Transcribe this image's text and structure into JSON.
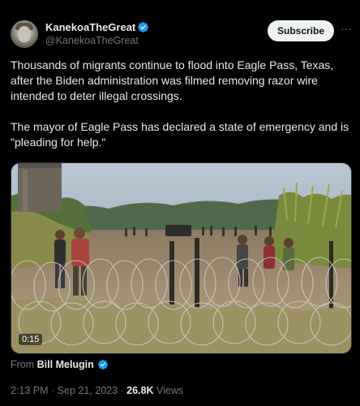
{
  "author": {
    "display_name": "KanekoaTheGreat",
    "handle": "@KanekoaTheGreat",
    "verified_color": "#1d9bf0"
  },
  "header": {
    "subscribe_label": "Subscribe",
    "more_label": "···"
  },
  "tweet": {
    "paragraph_1": "Thousands of migrants continue to flood into Eagle Pass, Texas, after the Biden administration was filmed removing razor wire intended to deter illegal crossings.",
    "paragraph_2": "The mayor of Eagle Pass has declared a state of emergency and is \"pleading for help.\""
  },
  "media": {
    "video_timer": "0:15"
  },
  "attribution": {
    "from_label": "From",
    "source_name": "Bill Melugin"
  },
  "meta": {
    "time": "2:13 PM",
    "separator": " · ",
    "date": "Sep 21, 2023",
    "views_count": "26.8K",
    "views_label": "Views"
  },
  "colors": {
    "background": "#000000",
    "text": "#e7e9ea",
    "secondary": "#71767b",
    "accent": "#1d9bf0"
  }
}
